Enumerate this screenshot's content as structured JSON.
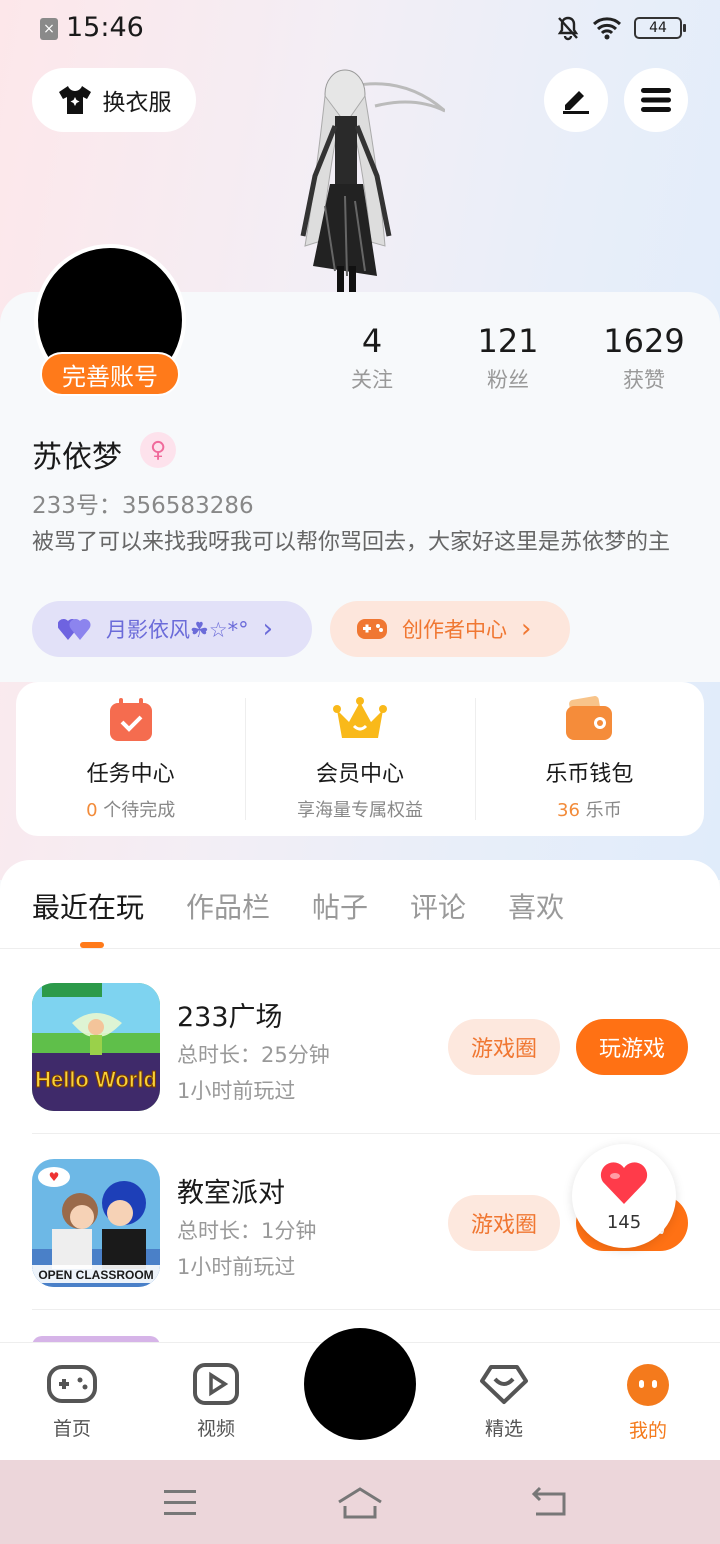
{
  "status_bar": {
    "time": "15:46",
    "battery": "44"
  },
  "header": {
    "change_outfit_label": "换衣服",
    "edit_icon": "pen-icon",
    "menu_icon": "menu-icon"
  },
  "profile": {
    "complete_account_label": "完善账号",
    "stats": [
      {
        "value": "4",
        "label": "关注"
      },
      {
        "value": "121",
        "label": "粉丝"
      },
      {
        "value": "1629",
        "label": "获赞"
      }
    ],
    "username": "苏依梦",
    "gender_icon": "female-icon",
    "uid_text": "233号：356583286",
    "bio": "被骂了可以来找我呀我可以帮你骂回去，大家好这里是苏依梦的主",
    "tag_friend": "月影依风☘☆*°",
    "tag_creator": "创作者中心"
  },
  "quick_actions": [
    {
      "title": "任务中心",
      "sub_highlight": "0",
      "sub_rest": " 个待完成",
      "icon": "calendar-check-icon"
    },
    {
      "title": "会员中心",
      "sub_highlight": "",
      "sub_rest": "享海量专属权益",
      "icon": "crown-icon"
    },
    {
      "title": "乐币钱包",
      "sub_highlight": "36",
      "sub_rest": " 乐币",
      "icon": "wallet-icon"
    }
  ],
  "tabs": [
    "最近在玩",
    "作品栏",
    "帖子",
    "评论",
    "喜欢"
  ],
  "games": [
    {
      "name": "233广场",
      "duration": "总时长：25分钟",
      "last_played": "1小时前玩过",
      "circle_btn": "游戏圈",
      "play_btn": "玩游戏",
      "icon_text": "Hello World"
    },
    {
      "name": "教室派对",
      "duration": "总时长：1分钟",
      "last_played": "1小时前玩过",
      "circle_btn": "游戏圈",
      "play_btn": "玩游戏",
      "icon_text": "OPEN CLASSROOM"
    }
  ],
  "floating_like": {
    "count": "145"
  },
  "bottom_nav": [
    {
      "label": "首页",
      "icon": "gamepad-icon"
    },
    {
      "label": "视频",
      "icon": "video-play-icon"
    },
    {
      "label": "精选",
      "icon": "heart-shield-icon"
    },
    {
      "label": "我的",
      "icon": "profile-face-icon"
    }
  ],
  "colors": {
    "accent": "#ff7114",
    "purple_tag": "#6b6bd9",
    "orange_tag": "#f07732"
  }
}
